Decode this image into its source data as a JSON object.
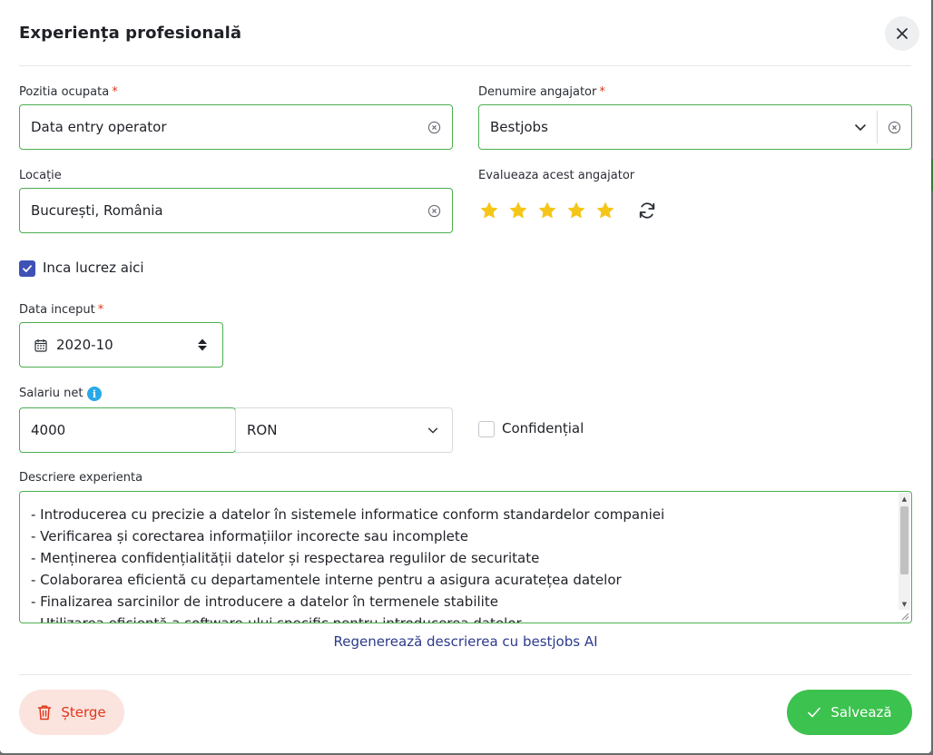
{
  "modal": {
    "title": "Experiența profesională"
  },
  "position": {
    "label": "Pozitia ocupata",
    "required_mark": "*",
    "value": "Data entry operator"
  },
  "employer": {
    "label": "Denumire angajator",
    "required_mark": "*",
    "value": "Bestjobs"
  },
  "location": {
    "label": "Locație",
    "value": "București, România"
  },
  "rating": {
    "label": "Evalueaza acest angajator",
    "stars": 5,
    "max": 5,
    "color": "#f5c518"
  },
  "current_job": {
    "label": "Inca lucrez aici",
    "checked": true
  },
  "start_date": {
    "label": "Data inceput",
    "required_mark": "*",
    "value": "2020-10"
  },
  "salary": {
    "label": "Salariu net",
    "info_glyph": "i",
    "amount": "4000",
    "currency": "RON",
    "confidential_label": "Confidențial",
    "confidential_checked": false
  },
  "description": {
    "label": "Descriere experienta",
    "lines": [
      "- Introducerea cu precizie a datelor în sistemele informatice conform standardelor companiei",
      "- Verificarea și corectarea informațiilor incorecte sau incomplete",
      "- Menținerea confidențialității datelor și respectarea regulilor de securitate",
      "- Colaborarea eficientă cu departamentele interne pentru a asigura acuratețea datelor",
      "- Finalizarea sarcinilor de introducere a datelor în termenele stabilite",
      "- Utilizarea eficientă a software-ului specific pentru introducerea datelor"
    ],
    "regenerate_label": "Regenerează descrierea cu bestjobs AI"
  },
  "actions": {
    "delete_label": "Șterge",
    "save_label": "Salvează"
  },
  "colors": {
    "accent_green": "#4caf50",
    "save_green": "#3cc24e",
    "delete_red": "#e0361a",
    "checkbox_blue": "#3f51b5",
    "link_blue": "#2d3a8c"
  }
}
